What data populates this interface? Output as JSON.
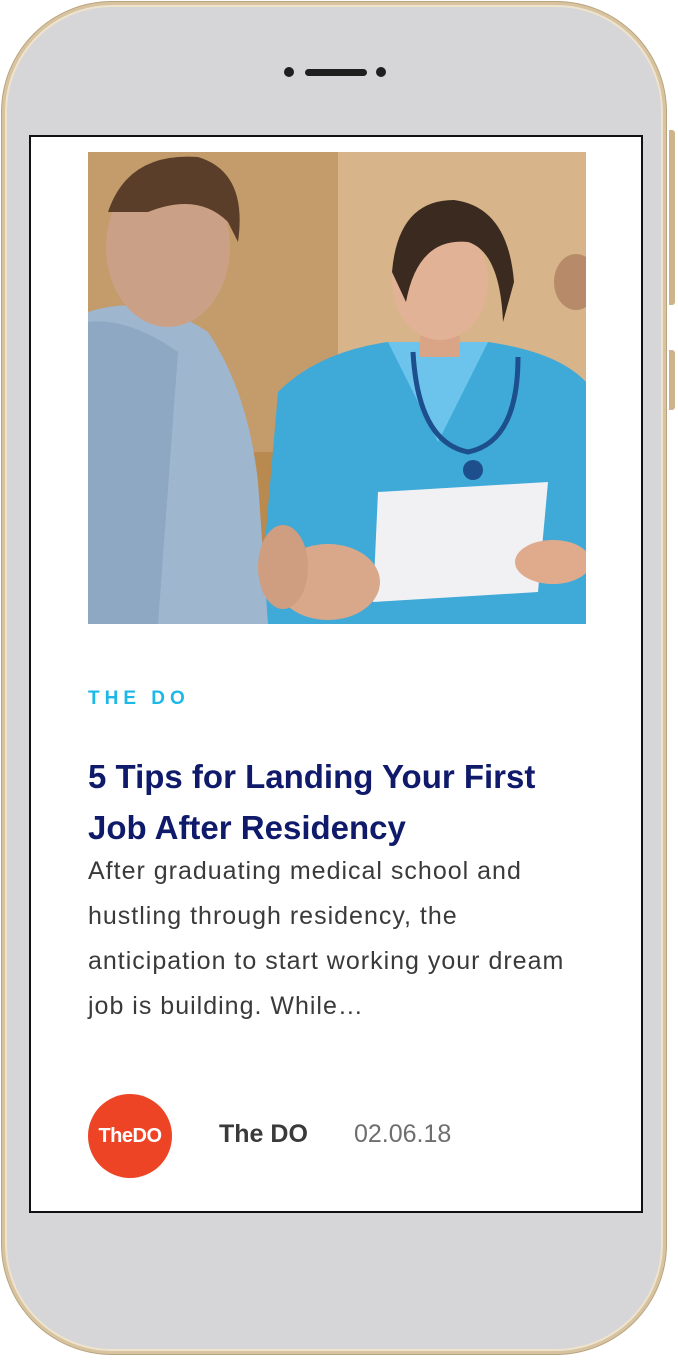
{
  "article": {
    "category": "THE DO",
    "title": "5 Tips for Landing Your First Job After Residency",
    "excerpt": "After graduating medical school and hustling through residency, the anticipation to start working your dream job is building. While…",
    "image_description": "",
    "author": {
      "avatar_text": "TheDO",
      "name": "The DO"
    },
    "date": "02.06.18"
  },
  "colors": {
    "category": "#1cb9e6",
    "title": "#0f1a6b",
    "avatar_bg": "#ee4426",
    "phone_frame": "#d6d6d8",
    "phone_trim": "#d8c3a0"
  }
}
